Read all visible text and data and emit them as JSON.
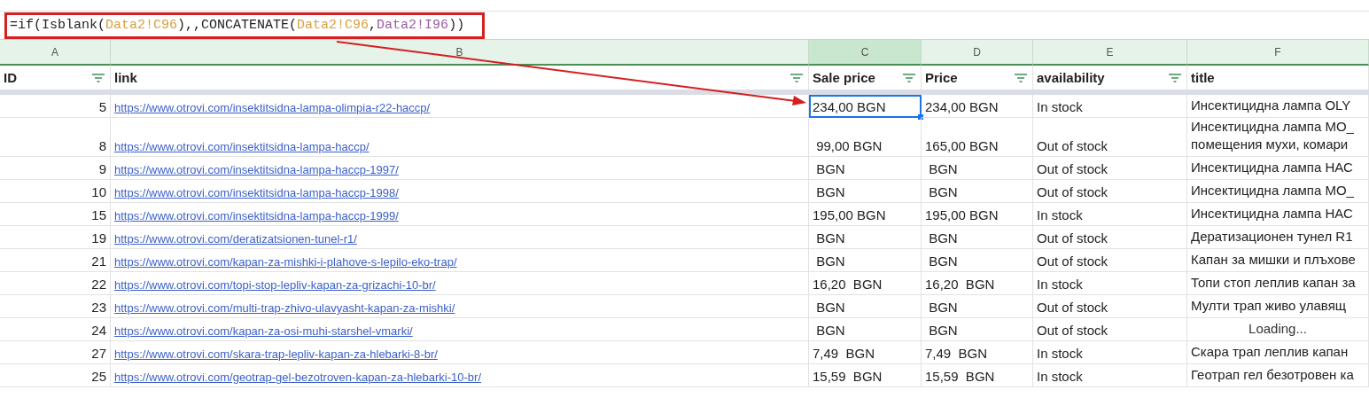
{
  "formula_bar": {
    "segments": [
      {
        "text": "=if(Isblank(",
        "color": "#222222"
      },
      {
        "text": "Data2!C96",
        "color": "#d69f3c"
      },
      {
        "text": "),,CONCATENATE(",
        "color": "#222222"
      },
      {
        "text": "Data2!C96",
        "color": "#d69f3c"
      },
      {
        "text": ",",
        "color": "#222222"
      },
      {
        "text": "Data2!I96",
        "color": "#9b59a6"
      },
      {
        "text": "))",
        "color": "#222222"
      }
    ]
  },
  "column_letters": [
    {
      "label": "A",
      "selected": false
    },
    {
      "label": "B",
      "selected": false
    },
    {
      "label": "C",
      "selected": true
    },
    {
      "label": "D",
      "selected": false
    },
    {
      "label": "E",
      "selected": false
    },
    {
      "label": "F",
      "selected": false
    }
  ],
  "header": [
    {
      "label": "ID",
      "filter": true
    },
    {
      "label": "link",
      "filter": true
    },
    {
      "label": "Sale price",
      "filter": true
    },
    {
      "label": "Price",
      "filter": true
    },
    {
      "label": "availability",
      "filter": true
    },
    {
      "label": "title",
      "filter": false
    }
  ],
  "rows": [
    {
      "id": "5",
      "link": "https://www.otrovi.com/insektitsidna-lampa-olimpia-r22-haccp/",
      "sale_price": "234,00 BGN",
      "price": "234,00 BGN",
      "availability": "In stock",
      "title": "Инсектицидна лампа OLY",
      "loading": false,
      "selected": true
    },
    {
      "id": "8",
      "link": "https://www.otrovi.com/insektitsidna-lampa-haccp/",
      "sale_price": " 99,00 BGN",
      "price": "165,00 BGN",
      "availability": "Out of stock",
      "title": "Инсектицидна лампа МО_\nпомещения мухи, комари",
      "loading": false,
      "selected": false
    },
    {
      "id": "9",
      "link": "https://www.otrovi.com/insektitsidna-lampa-haccp-1997/",
      "sale_price": " BGN",
      "price": " BGN",
      "availability": "Out of stock",
      "title": "Инсектицидна лампа НАС",
      "loading": false,
      "selected": false
    },
    {
      "id": "10",
      "link": "https://www.otrovi.com/insektitsidna-lampa-haccp-1998/",
      "sale_price": " BGN",
      "price": " BGN",
      "availability": "Out of stock",
      "title": "Инсектицидна лампа МО_",
      "loading": false,
      "selected": false
    },
    {
      "id": "15",
      "link": "https://www.otrovi.com/insektitsidna-lampa-haccp-1999/",
      "sale_price": "195,00 BGN",
      "price": "195,00 BGN",
      "availability": "In stock",
      "title": "Инсектицидна лампа НАС",
      "loading": false,
      "selected": false
    },
    {
      "id": "19",
      "link": "https://www.otrovi.com/deratizatsionen-tunel-r1/",
      "sale_price": " BGN",
      "price": " BGN",
      "availability": "Out of stock",
      "title": "Дератизационен тунел R1",
      "loading": false,
      "selected": false
    },
    {
      "id": "21",
      "link": "https://www.otrovi.com/kapan-za-mishki-i-plahove-s-lepilo-eko-trap/",
      "sale_price": " BGN",
      "price": " BGN",
      "availability": "Out of stock",
      "title": "Капан за мишки и плъхове",
      "loading": false,
      "selected": false
    },
    {
      "id": "22",
      "link": "https://www.otrovi.com/topi-stop-lepliv-kapan-za-grizachi-10-br/",
      "sale_price": "16,20  BGN",
      "price": "16,20  BGN",
      "availability": "In stock",
      "title": "Топи стоп леплив капан за",
      "loading": false,
      "selected": false
    },
    {
      "id": "23",
      "link": "https://www.otrovi.com/multi-trap-zhivo-ulavyasht-kapan-za-mishki/",
      "sale_price": " BGN",
      "price": " BGN",
      "availability": "Out of stock",
      "title": "Мулти трап живо улавящ",
      "loading": false,
      "selected": false
    },
    {
      "id": "24",
      "link": "https://www.otrovi.com/kapan-za-osi-muhi-starshel-vmarki/",
      "sale_price": " BGN",
      "price": " BGN",
      "availability": "Out of stock",
      "title": "Loading...",
      "loading": true,
      "selected": false
    },
    {
      "id": "27",
      "link": "https://www.otrovi.com/skara-trap-lepliv-kapan-za-hlebarki-8-br/",
      "sale_price": "7,49  BGN",
      "price": "7,49  BGN",
      "availability": "In stock",
      "title": "Скара трап леплив капан",
      "loading": false,
      "selected": false
    },
    {
      "id": "25",
      "link": "https://www.otrovi.com/geotrap-gel-bezotroven-kapan-za-hlebarki-10-br/",
      "sale_price": "15,59  BGN",
      "price": "15,59  BGN",
      "availability": "In stock",
      "title": "Геотрап гел безотровен ка",
      "loading": false,
      "selected": false
    }
  ]
}
